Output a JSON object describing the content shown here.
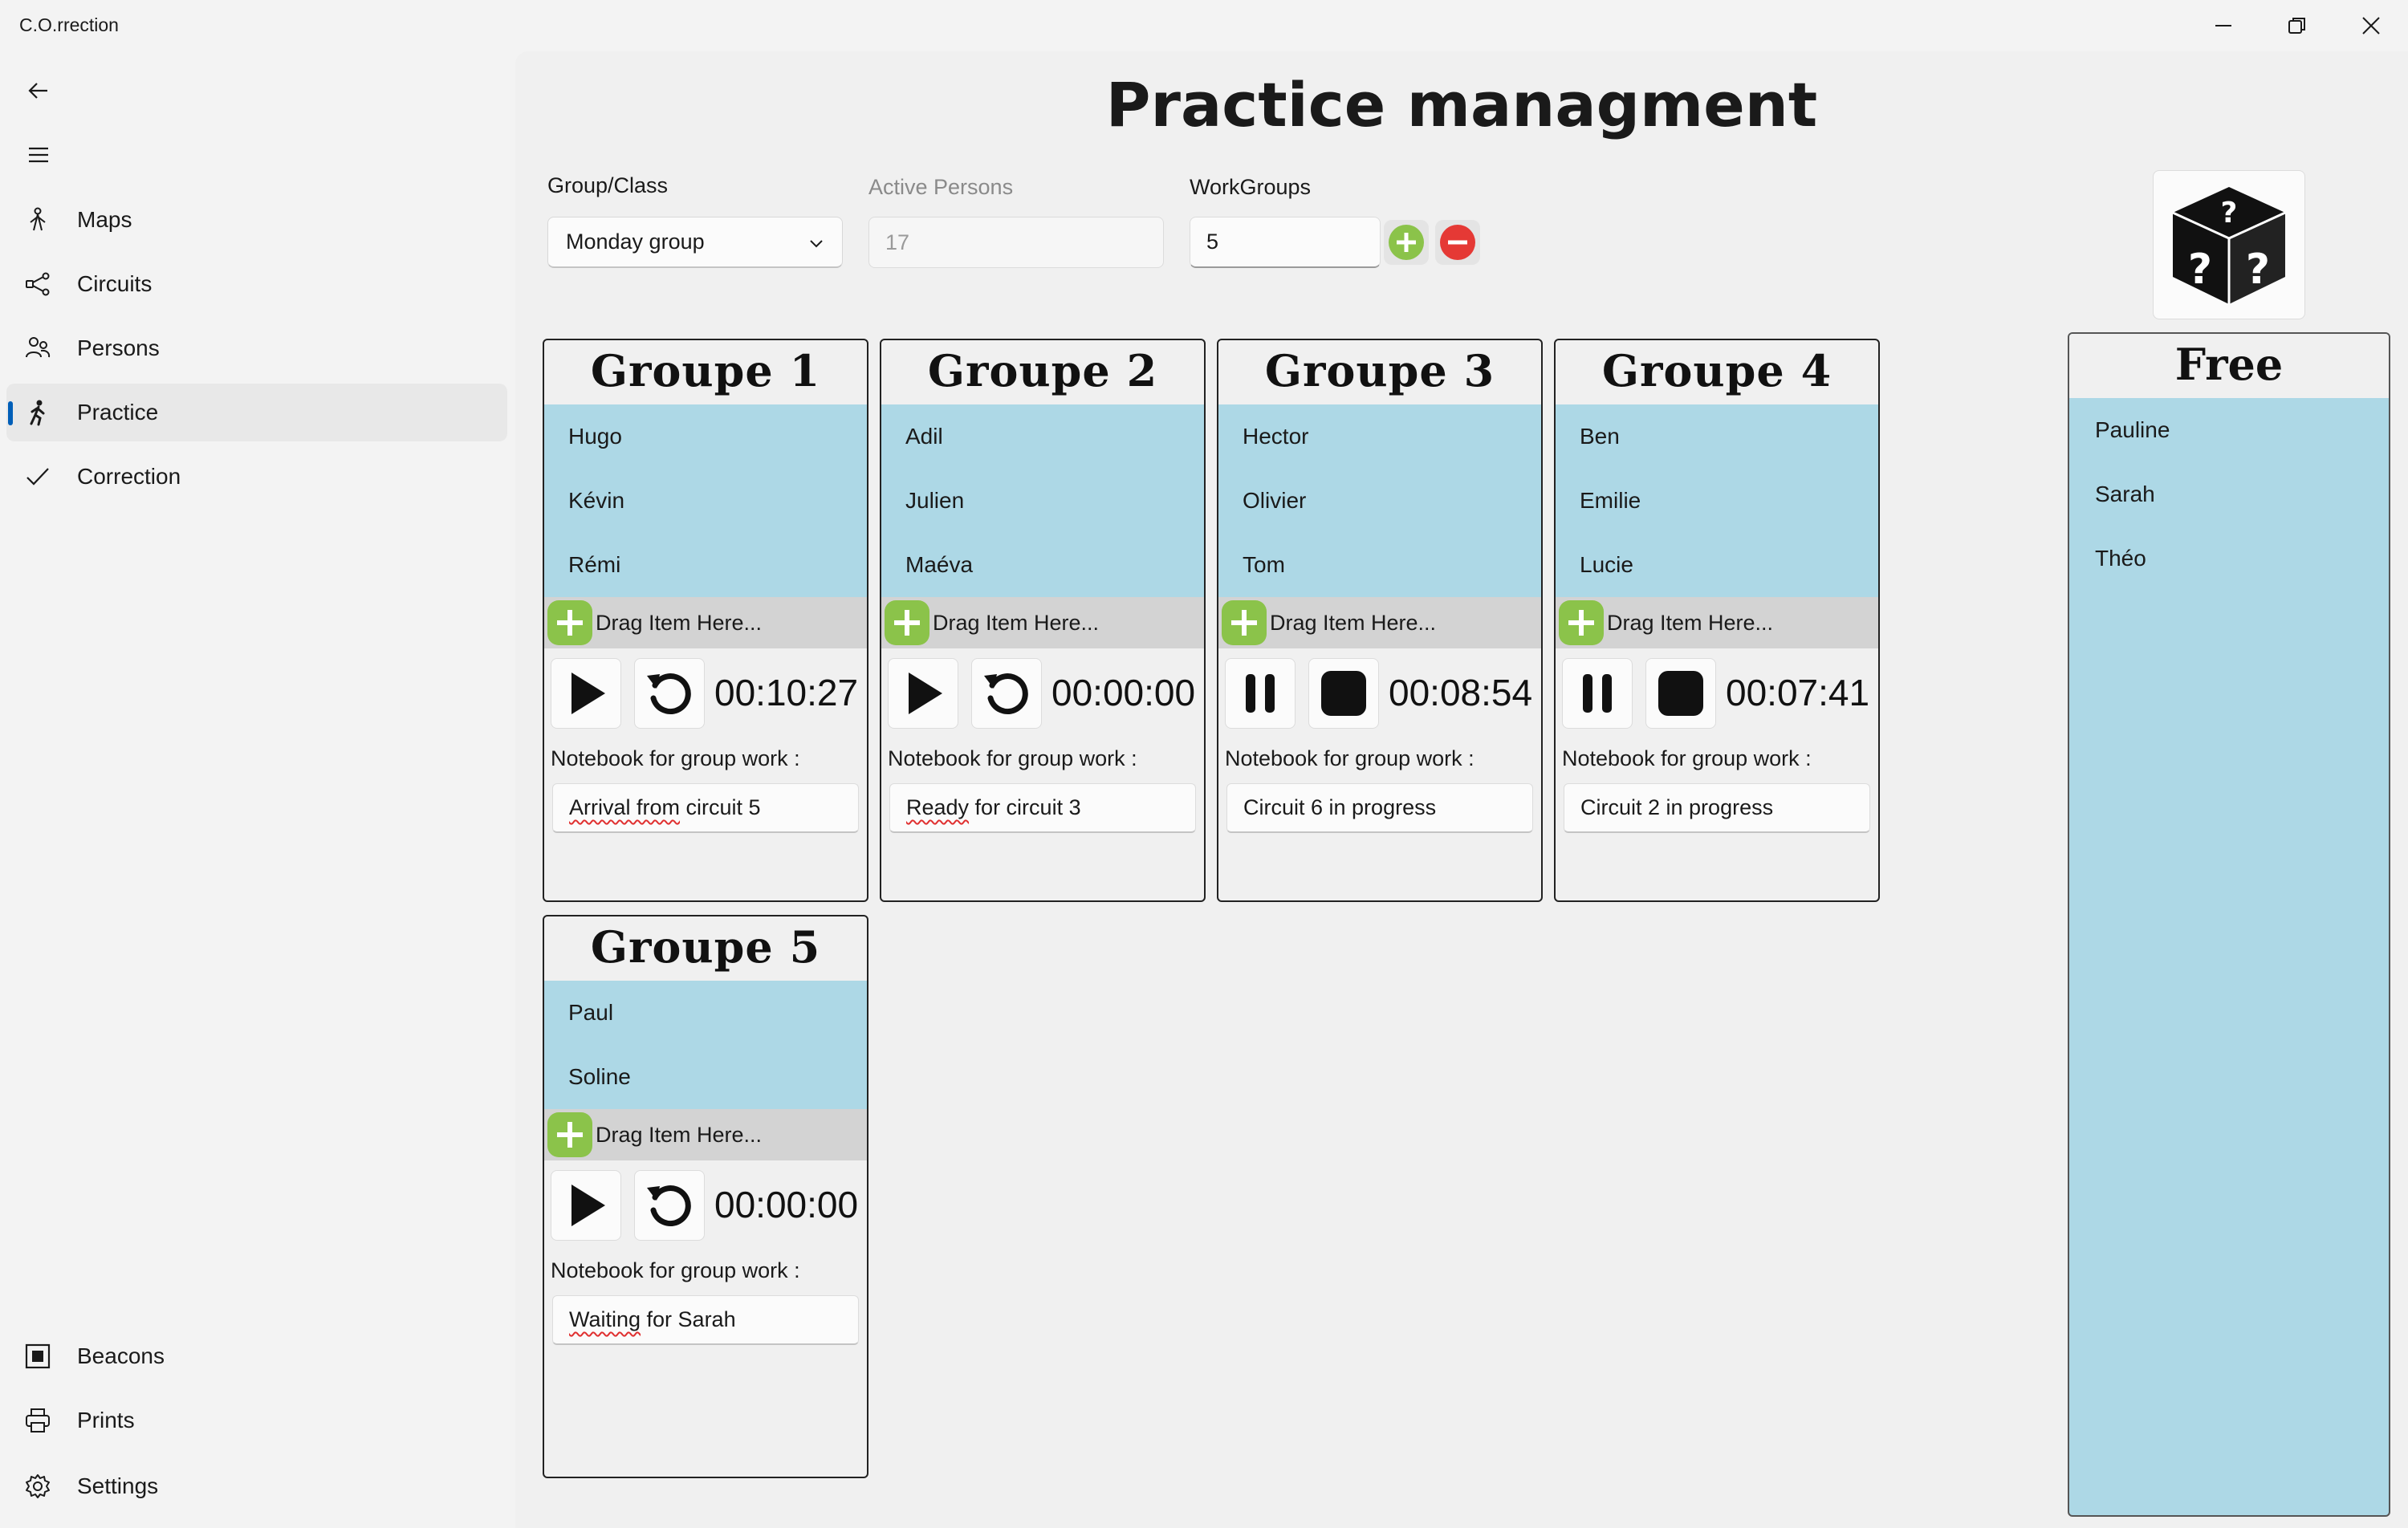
{
  "app": {
    "title": "C.O.rrection"
  },
  "sidebar": {
    "items": [
      {
        "label": "Maps",
        "icon": "hiker-icon"
      },
      {
        "label": "Circuits",
        "icon": "share-nodes-icon"
      },
      {
        "label": "Persons",
        "icon": "people-icon"
      },
      {
        "label": "Practice",
        "icon": "running-icon",
        "active": true
      },
      {
        "label": "Correction",
        "icon": "checkmark-icon"
      }
    ],
    "footer_items": [
      {
        "label": "Beacons",
        "icon": "beacon-icon"
      },
      {
        "label": "Prints",
        "icon": "printer-icon"
      },
      {
        "label": "Settings",
        "icon": "gear-icon"
      }
    ]
  },
  "main": {
    "title": "Practice managment",
    "group_class": {
      "label": "Group/Class",
      "value": "Monday group"
    },
    "active_persons": {
      "label": "Active Persons",
      "value": "17"
    },
    "workgroups": {
      "label": "WorkGroups",
      "value": "5"
    }
  },
  "groups": [
    {
      "title": "Groupe 1",
      "members": [
        "Hugo",
        "Kévin",
        "Rémi"
      ],
      "drop_text": "Drag Item Here...",
      "state": "stopped",
      "timer": "00:10:27",
      "notebook_label": "Notebook for group work :",
      "notebook": "Arrival from circuit 5",
      "notebook_parts": [
        "Arrival from",
        " circuit 5"
      ]
    },
    {
      "title": "Groupe 2",
      "members": [
        "Adil",
        "Julien",
        "Maéva"
      ],
      "drop_text": "Drag Item Here...",
      "state": "stopped",
      "timer": "00:00:00",
      "notebook_label": "Notebook for group work :",
      "notebook": "Ready for circuit 3",
      "notebook_parts": [
        "Ready",
        " for circuit 3"
      ]
    },
    {
      "title": "Groupe 3",
      "members": [
        "Hector",
        "Olivier",
        "Tom"
      ],
      "drop_text": "Drag Item Here...",
      "state": "running",
      "timer": "00:08:54",
      "notebook_label": "Notebook for group work :",
      "notebook": "Circuit 6 in progress"
    },
    {
      "title": "Groupe 4",
      "members": [
        "Ben",
        "Emilie",
        "Lucie"
      ],
      "drop_text": "Drag Item Here...",
      "state": "running",
      "timer": "00:07:41",
      "notebook_label": "Notebook for group work :",
      "notebook": "Circuit 2 in progress"
    },
    {
      "title": "Groupe 5",
      "members": [
        "Paul",
        "Soline"
      ],
      "drop_text": "Drag Item Here...",
      "state": "stopped",
      "timer": "00:00:00",
      "notebook_label": "Notebook for group work :",
      "notebook": "Waiting for Sarah",
      "notebook_parts": [
        "Waiting",
        " for Sarah"
      ]
    }
  ],
  "free": {
    "title": "Free",
    "members": [
      "Pauline",
      "Sarah",
      "Théo"
    ]
  },
  "colors": {
    "member_bg": "#add8e6",
    "drop_bg": "#d3d3d3",
    "add_green": "#8bc34a",
    "remove_red": "#e53935",
    "accent": "#005fb8"
  }
}
